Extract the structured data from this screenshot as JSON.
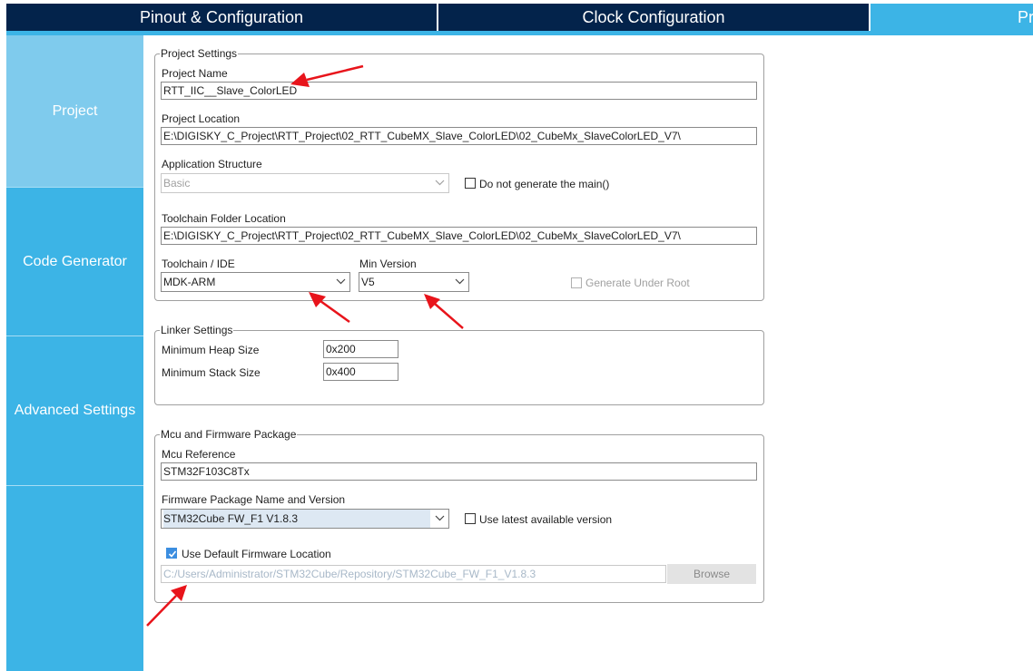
{
  "tabs": {
    "pinout": "Pinout & Configuration",
    "clock": "Clock Configuration",
    "project_manager": "Pr"
  },
  "sidebar": {
    "items": [
      {
        "label": "Project"
      },
      {
        "label": "Code Generator"
      },
      {
        "label": "Advanced Settings"
      }
    ]
  },
  "project_settings": {
    "legend": "Project Settings",
    "project_name_label": "Project Name",
    "project_name_value": "RTT_IIC__Slave_ColorLED",
    "project_location_label": "Project Location",
    "project_location_value": "E:\\DIGISKY_C_Project\\RTT_Project\\02_RTT_CubeMX_Slave_ColorLED\\02_CubeMx_SlaveColorLED_V7\\",
    "app_structure_label": "Application Structure",
    "app_structure_value": "Basic",
    "no_main_label": "Do not generate the main()",
    "toolchain_folder_label": "Toolchain Folder Location",
    "toolchain_folder_value": "E:\\DIGISKY_C_Project\\RTT_Project\\02_RTT_CubeMX_Slave_ColorLED\\02_CubeMx_SlaveColorLED_V7\\",
    "toolchain_ide_label": "Toolchain / IDE",
    "toolchain_ide_value": "MDK-ARM",
    "min_version_label": "Min Version",
    "min_version_value": "V5",
    "generate_under_root_label": "Generate Under Root"
  },
  "linker_settings": {
    "legend": "Linker Settings",
    "heap_label": "Minimum Heap Size",
    "heap_value": "0x200",
    "stack_label": "Minimum Stack Size",
    "stack_value": "0x400"
  },
  "mcu_firmware": {
    "legend": "Mcu and Firmware Package",
    "mcu_ref_label": "Mcu Reference",
    "mcu_ref_value": "STM32F103C8Tx",
    "fw_label": "Firmware Package Name and Version",
    "fw_value": "STM32Cube FW_F1 V1.8.3",
    "use_latest_label": "Use latest available version",
    "use_default_label": "Use Default Firmware Location",
    "fw_location_value": "C:/Users/Administrator/STM32Cube/Repository/STM32Cube_FW_F1_V1.8.3",
    "browse_label": "Browse"
  },
  "checkbox_states": {
    "no_main": false,
    "generate_under_root": false,
    "use_latest": false,
    "use_default": true
  },
  "icons": [
    "chevron-down-icon",
    "checkmark-icon",
    "red-annotation-arrow"
  ],
  "colors": {
    "tab_dark": "#03234b",
    "accent_blue": "#3cb4e6",
    "sidebar_active": "#7fcbed",
    "annotation_red": "#e8141b",
    "checkbox_checked": "#3c8ee0"
  }
}
